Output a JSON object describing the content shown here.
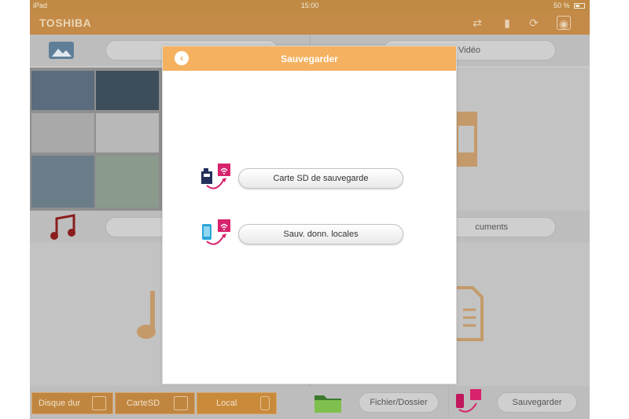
{
  "status_bar": {
    "device": "iPad",
    "time": "15:00",
    "battery": "50 %"
  },
  "app": {
    "brand": "TOSHIBA"
  },
  "header_icons": [
    "transfer-icon",
    "battery-icon",
    "sync-icon",
    "camera-settings-icon"
  ],
  "background": {
    "tiles": [
      {
        "label": ""
      },
      {
        "label": "Vidéo"
      },
      {
        "label": ""
      },
      {
        "label": "cuments"
      }
    ]
  },
  "bottom_tabs": [
    {
      "label": "Disque dur",
      "icon": "hard-disk-icon"
    },
    {
      "label": "CarteSD",
      "icon": "sd-card-icon"
    },
    {
      "label": "Local",
      "icon": "tablet-icon",
      "active": true
    }
  ],
  "bottom_actions": {
    "folder_button": "Fichier/Dossier",
    "backup_button": "Sauvegarder"
  },
  "modal": {
    "title": "Sauvegarder",
    "options": [
      {
        "label": "Carte SD de sauvegarde",
        "icon": "sd-to-wifi-icon"
      },
      {
        "label": "Sauv. donn. locales",
        "icon": "phone-to-wifi-icon"
      }
    ]
  },
  "colors": {
    "accent": "#f5b160",
    "header_brown": "#c48a48",
    "magenta": "#d8226c"
  }
}
